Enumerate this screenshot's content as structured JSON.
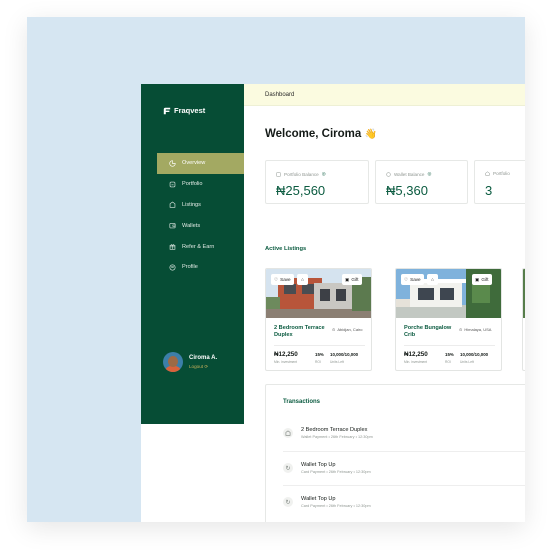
{
  "app": {
    "brand": "Fraqvest",
    "breadcrumb": "Dashboard",
    "welcome": "Welcome, Ciroma",
    "wave": "👋"
  },
  "sidebar": {
    "items": [
      {
        "label": "Overview",
        "icon": "overview-icon",
        "active": true
      },
      {
        "label": "Portfolio",
        "icon": "portfolio-icon"
      },
      {
        "label": "Listings",
        "icon": "listings-icon"
      },
      {
        "label": "Wallets",
        "icon": "wallet-icon"
      },
      {
        "label": "Refer & Earn",
        "icon": "gift-icon"
      },
      {
        "label": "Profile",
        "icon": "profile-icon"
      }
    ],
    "user": {
      "name": "Ciroma A.",
      "logout": "Logout"
    }
  },
  "stats": [
    {
      "label": "Portfolio Balance",
      "value": "₦25,560",
      "icon": "portfolio-icon"
    },
    {
      "label": "Wallet Balance",
      "value": "₦5,360",
      "icon": "wallet-icon"
    },
    {
      "label": "Portfolio",
      "value": "3",
      "icon": "home-icon"
    }
  ],
  "listings_title": "Active Listings",
  "listings": [
    {
      "title": "2 Bedroom Terrace Duplex",
      "location": "Abidjan, Cairo",
      "price": "₦12,250",
      "price_sub": "Min. investment",
      "roi": "15%",
      "roi_sub": "ROI",
      "units": "10,000/10,000",
      "units_sub": "Units Left",
      "save": "Save",
      "gift": "Gift"
    },
    {
      "title": "Porche Bungalow Crib",
      "location": "Himalaya, USA",
      "price": "₦12,250",
      "price_sub": "Min. investment",
      "roi": "15%",
      "roi_sub": "ROI",
      "units": "10,000/10,000",
      "units_sub": "Units Left",
      "save": "Save",
      "gift": "Gift"
    }
  ],
  "transactions": {
    "title": "Transactions",
    "rows": [
      {
        "name": "2 Bedroom Terrace Duplex",
        "type": "Wallet Payment",
        "date": "26th February",
        "time": "12:30pm",
        "icon": "home-icon"
      },
      {
        "name": "Wallet Top Up",
        "type": "Card Payment",
        "date": "26th February",
        "time": "12:30pm",
        "icon": "refresh-icon"
      },
      {
        "name": "Wallet Top Up",
        "type": "Card Payment",
        "date": "26th February",
        "time": "12:30pm",
        "icon": "refresh-icon"
      }
    ]
  },
  "colors": {
    "sidebar_bg": "#064d35",
    "active_item": "#a3a962",
    "brand_green": "#0b5b40",
    "topbar_bg": "#fbfbe0",
    "canvas_bg": "#d6e6f2"
  }
}
